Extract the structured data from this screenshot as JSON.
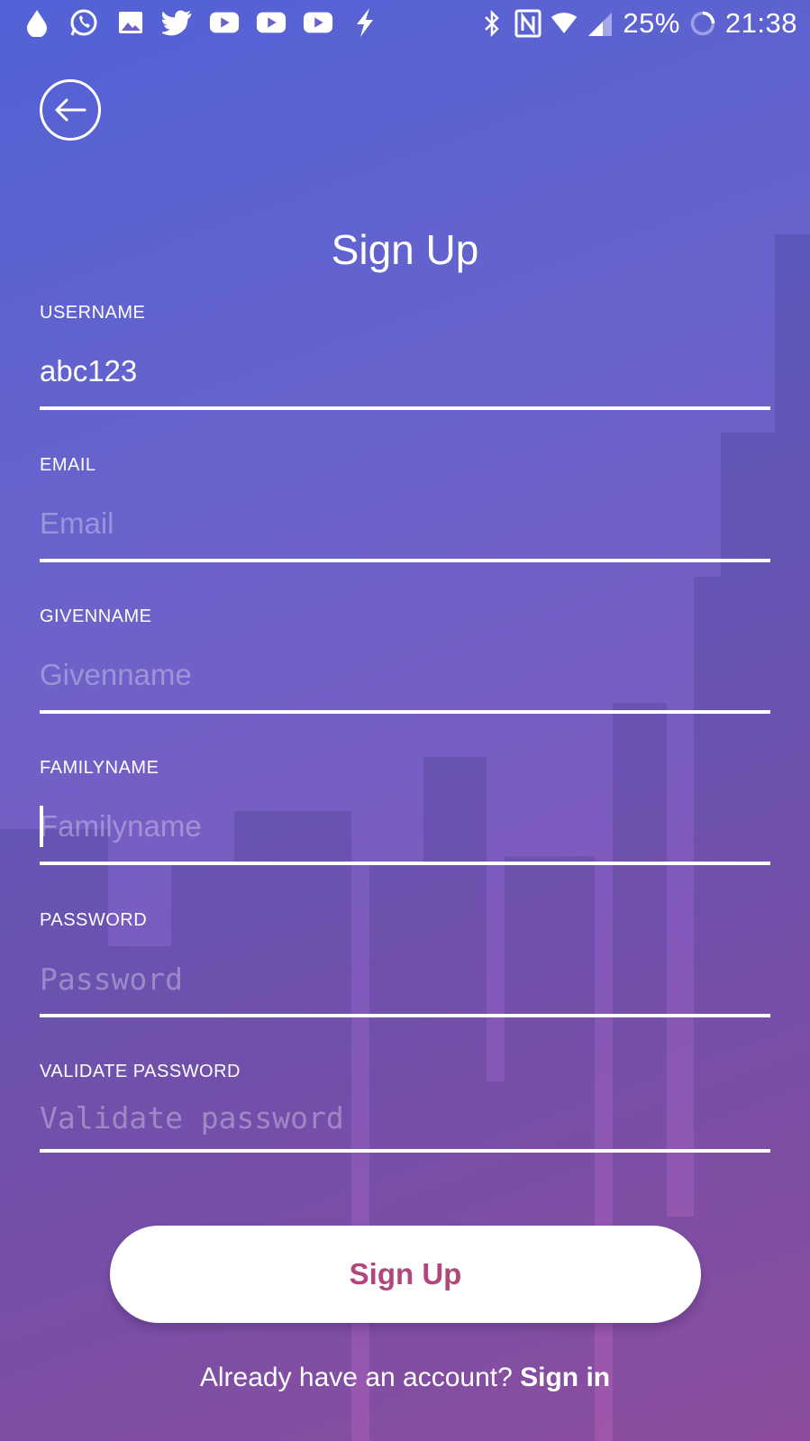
{
  "status_bar": {
    "left_icons": [
      "water-drop-icon",
      "whatsapp-icon",
      "image-icon",
      "twitter-icon",
      "youtube-icon",
      "youtube-icon",
      "youtube-icon",
      "flash-icon"
    ],
    "right_icons": [
      "bluetooth-icon",
      "nfc-icon",
      "wifi-icon",
      "cell-signal-icon"
    ],
    "battery": "25%",
    "time": "21:38"
  },
  "header": {
    "back_icon": "arrow-left-circle-icon",
    "title": "Sign Up"
  },
  "form": {
    "username": {
      "label": "USERNAME",
      "value": "abc123",
      "placeholder": ""
    },
    "email": {
      "label": "EMAIL",
      "value": "",
      "placeholder": "Email"
    },
    "givenname": {
      "label": "GIVENNAME",
      "value": "",
      "placeholder": "Givenname"
    },
    "familyname": {
      "label": "FAMILYNAME",
      "value": "",
      "placeholder": "Familyname"
    },
    "password": {
      "label": "PASSWORD",
      "value": "",
      "placeholder": "Password"
    },
    "validate_password": {
      "label": "VALIDATE PASSWORD",
      "value": "",
      "placeholder": "Validate password"
    }
  },
  "actions": {
    "signup_label": "Sign Up"
  },
  "footer": {
    "prompt": "Already have an account?",
    "signin_label": "Sign in"
  },
  "colors": {
    "gradient_start": "#5262d6",
    "gradient_end": "#a456a8",
    "button_text": "#b2467c",
    "underline": "#ffffff"
  }
}
